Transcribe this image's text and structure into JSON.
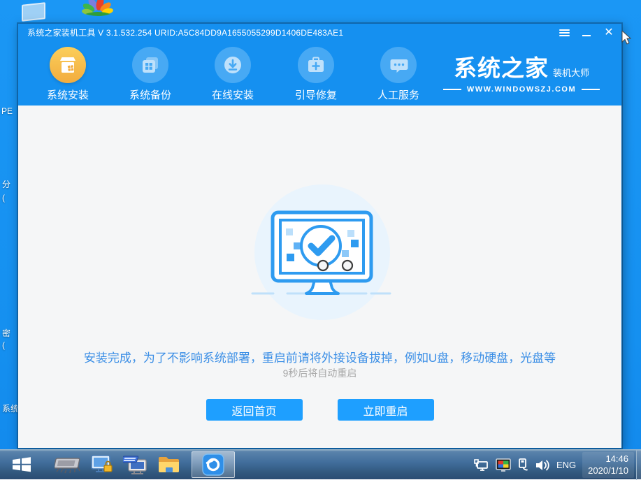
{
  "desktop": {
    "icon_fragments": {
      "pe_label": "PE",
      "partition_label": "分",
      "partition_paren": "(",
      "password_label": "密",
      "password_paren": "(",
      "system_label": "系统"
    }
  },
  "window": {
    "title": "系统之家装机工具 V 3.1.532.254 URID:A5C84DD9A1655055299D1406DE483AE1",
    "close_glyph": "✕"
  },
  "nav": {
    "items": [
      {
        "label": "系统安装",
        "icon": "install-box-icon",
        "active": true
      },
      {
        "label": "系统备份",
        "icon": "backup-windows-icon",
        "active": false
      },
      {
        "label": "在线安装",
        "icon": "download-icon",
        "active": false
      },
      {
        "label": "引导修复",
        "icon": "repair-toolbox-icon",
        "active": false
      },
      {
        "label": "人工服务",
        "icon": "chat-service-icon",
        "active": false
      }
    ],
    "logo": {
      "brand": "系统之家",
      "tagline": "装机大师",
      "website": "WWW.WINDOWSZJ.COM"
    }
  },
  "main": {
    "message": "安装完成，为了不影响系统部署，重启前请将外接设备拔掉，例如U盘，移动硬盘，光盘等",
    "countdown": "9秒后将自动重启",
    "home_button": "返回首页",
    "restart_button": "立即重启"
  },
  "taskbar": {
    "language": "ENG",
    "time": "14:46",
    "date": "2020/1/10"
  },
  "colors": {
    "header_blue": "#1590F0",
    "desktop_blue": "#1B97F5",
    "inactive_circle_blue": "#47A9F4",
    "accent_gold": "#F5B844",
    "button_blue": "#1E9FFF",
    "message_blue": "#3A8EE6",
    "content_gray": "#F5F6F7"
  }
}
